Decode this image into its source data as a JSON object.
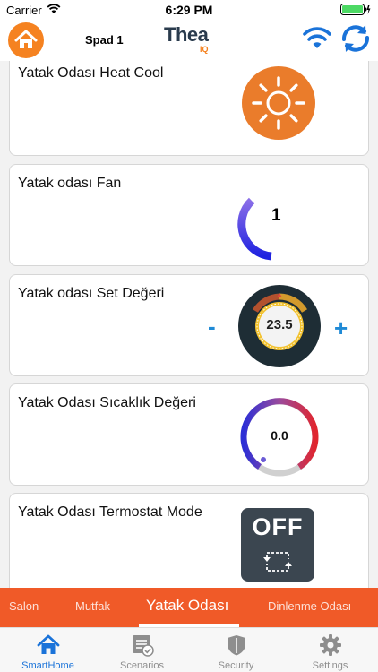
{
  "status_bar": {
    "carrier": "Carrier",
    "time": "6:29 PM"
  },
  "header": {
    "device_name": "Spad 1",
    "logo_text": "Thea",
    "logo_sub": "IQ"
  },
  "cards": {
    "heat_cool": {
      "title": "Yatak Odası Heat Cool",
      "icon": "sun-icon"
    },
    "fan": {
      "title": "Yatak odası Fan",
      "value": "1",
      "level": 1
    },
    "setpoint": {
      "title": "Yatak odası Set Değeri",
      "value": "23.5",
      "minus": "-",
      "plus": "+"
    },
    "temperature": {
      "title": "Yatak Odası Sıcaklık Değeri",
      "value": "0.0"
    },
    "thermostat_mode": {
      "title": "Yatak Odası Termostat Mode",
      "value": "OFF"
    }
  },
  "room_tabs": {
    "items": [
      "Salon",
      "Mutfak",
      "Yatak Odası",
      "Dinlenme Odası"
    ],
    "active": "Yatak Odası"
  },
  "bottom_nav": {
    "items": [
      "SmartHome",
      "Scenarios",
      "Security",
      "Settings"
    ],
    "active": "SmartHome"
  },
  "colors": {
    "accent_orange": "#f58220",
    "tab_bar": "#f05a28",
    "blue": "#1a73d9",
    "dark_gray": "#3b4650"
  }
}
